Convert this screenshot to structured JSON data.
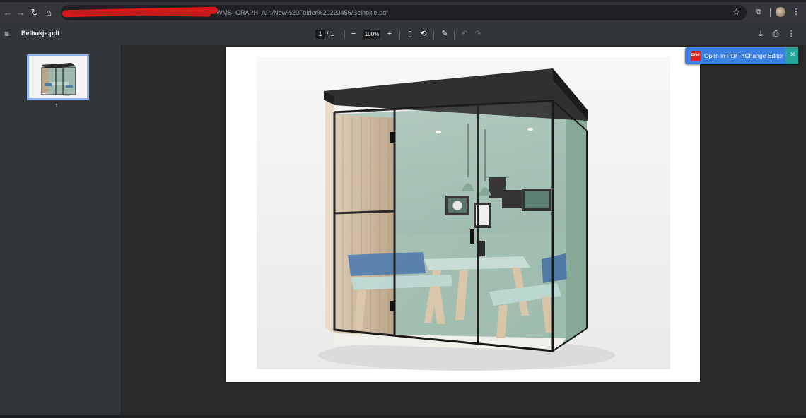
{
  "browser": {
    "url_host": "",
    "url_path": "WMS_GRAPH_API/New%20Folder%20223456/Belhokje.pdf",
    "icons": [
      "arrow-back-icon",
      "arrow-forward-icon",
      "reload-icon",
      "home-icon",
      "bookmark-star-icon",
      "extensions-icon",
      "profile-avatar"
    ]
  },
  "pdf_toolbar": {
    "title": "Belhokje.pdf",
    "page_current": "1",
    "page_total": "/  1",
    "zoom": "100%"
  },
  "sidebar": {
    "thumbnails": [
      {
        "label": "1"
      }
    ]
  },
  "popup": {
    "label": "Open in PDF-XChange Editor",
    "logo_text": "PDF"
  },
  "colors": {
    "accent": "#8ab4f8",
    "popup_blue": "#3b7fe0",
    "popup_teal": "#2aa39b",
    "toolbar": "#323639"
  }
}
